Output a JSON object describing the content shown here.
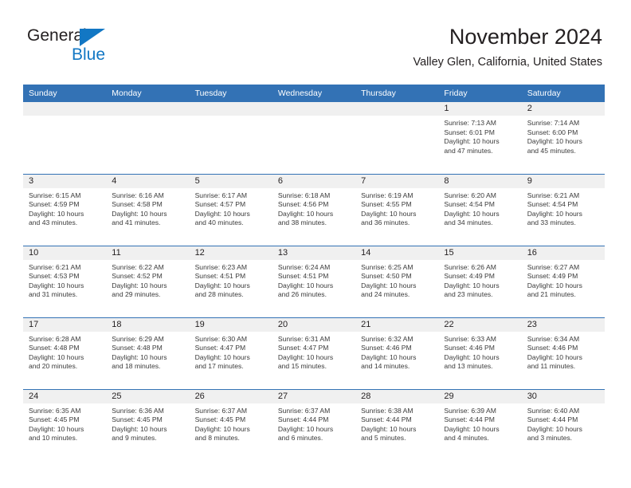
{
  "brand": {
    "name_part1": "General",
    "name_part2": "Blue",
    "accent_color": "#1277c4"
  },
  "header": {
    "title": "November 2024",
    "subtitle": "Valley Glen, California, United States"
  },
  "theme": {
    "header_blue": "#3372b5",
    "daynum_band": "#f0f0f0",
    "text": "#231f20"
  },
  "weekdays": [
    "Sunday",
    "Monday",
    "Tuesday",
    "Wednesday",
    "Thursday",
    "Friday",
    "Saturday"
  ],
  "labels": {
    "sunrise_prefix": "Sunrise:",
    "sunset_prefix": "Sunset:",
    "daylight_prefix": "Daylight:"
  },
  "weeks": [
    [
      {
        "day": "",
        "blank": true
      },
      {
        "day": "",
        "blank": true
      },
      {
        "day": "",
        "blank": true
      },
      {
        "day": "",
        "blank": true
      },
      {
        "day": "",
        "blank": true
      },
      {
        "day": "1",
        "sunrise": "Sunrise: 7:13 AM",
        "sunset": "Sunset: 6:01 PM",
        "daylight_line1": "Daylight: 10 hours",
        "daylight_line2": "and 47 minutes."
      },
      {
        "day": "2",
        "sunrise": "Sunrise: 7:14 AM",
        "sunset": "Sunset: 6:00 PM",
        "daylight_line1": "Daylight: 10 hours",
        "daylight_line2": "and 45 minutes."
      }
    ],
    [
      {
        "day": "3",
        "sunrise": "Sunrise: 6:15 AM",
        "sunset": "Sunset: 4:59 PM",
        "daylight_line1": "Daylight: 10 hours",
        "daylight_line2": "and 43 minutes."
      },
      {
        "day": "4",
        "sunrise": "Sunrise: 6:16 AM",
        "sunset": "Sunset: 4:58 PM",
        "daylight_line1": "Daylight: 10 hours",
        "daylight_line2": "and 41 minutes."
      },
      {
        "day": "5",
        "sunrise": "Sunrise: 6:17 AM",
        "sunset": "Sunset: 4:57 PM",
        "daylight_line1": "Daylight: 10 hours",
        "daylight_line2": "and 40 minutes."
      },
      {
        "day": "6",
        "sunrise": "Sunrise: 6:18 AM",
        "sunset": "Sunset: 4:56 PM",
        "daylight_line1": "Daylight: 10 hours",
        "daylight_line2": "and 38 minutes."
      },
      {
        "day": "7",
        "sunrise": "Sunrise: 6:19 AM",
        "sunset": "Sunset: 4:55 PM",
        "daylight_line1": "Daylight: 10 hours",
        "daylight_line2": "and 36 minutes."
      },
      {
        "day": "8",
        "sunrise": "Sunrise: 6:20 AM",
        "sunset": "Sunset: 4:54 PM",
        "daylight_line1": "Daylight: 10 hours",
        "daylight_line2": "and 34 minutes."
      },
      {
        "day": "9",
        "sunrise": "Sunrise: 6:21 AM",
        "sunset": "Sunset: 4:54 PM",
        "daylight_line1": "Daylight: 10 hours",
        "daylight_line2": "and 33 minutes."
      }
    ],
    [
      {
        "day": "10",
        "sunrise": "Sunrise: 6:21 AM",
        "sunset": "Sunset: 4:53 PM",
        "daylight_line1": "Daylight: 10 hours",
        "daylight_line2": "and 31 minutes."
      },
      {
        "day": "11",
        "sunrise": "Sunrise: 6:22 AM",
        "sunset": "Sunset: 4:52 PM",
        "daylight_line1": "Daylight: 10 hours",
        "daylight_line2": "and 29 minutes."
      },
      {
        "day": "12",
        "sunrise": "Sunrise: 6:23 AM",
        "sunset": "Sunset: 4:51 PM",
        "daylight_line1": "Daylight: 10 hours",
        "daylight_line2": "and 28 minutes."
      },
      {
        "day": "13",
        "sunrise": "Sunrise: 6:24 AM",
        "sunset": "Sunset: 4:51 PM",
        "daylight_line1": "Daylight: 10 hours",
        "daylight_line2": "and 26 minutes."
      },
      {
        "day": "14",
        "sunrise": "Sunrise: 6:25 AM",
        "sunset": "Sunset: 4:50 PM",
        "daylight_line1": "Daylight: 10 hours",
        "daylight_line2": "and 24 minutes."
      },
      {
        "day": "15",
        "sunrise": "Sunrise: 6:26 AM",
        "sunset": "Sunset: 4:49 PM",
        "daylight_line1": "Daylight: 10 hours",
        "daylight_line2": "and 23 minutes."
      },
      {
        "day": "16",
        "sunrise": "Sunrise: 6:27 AM",
        "sunset": "Sunset: 4:49 PM",
        "daylight_line1": "Daylight: 10 hours",
        "daylight_line2": "and 21 minutes."
      }
    ],
    [
      {
        "day": "17",
        "sunrise": "Sunrise: 6:28 AM",
        "sunset": "Sunset: 4:48 PM",
        "daylight_line1": "Daylight: 10 hours",
        "daylight_line2": "and 20 minutes."
      },
      {
        "day": "18",
        "sunrise": "Sunrise: 6:29 AM",
        "sunset": "Sunset: 4:48 PM",
        "daylight_line1": "Daylight: 10 hours",
        "daylight_line2": "and 18 minutes."
      },
      {
        "day": "19",
        "sunrise": "Sunrise: 6:30 AM",
        "sunset": "Sunset: 4:47 PM",
        "daylight_line1": "Daylight: 10 hours",
        "daylight_line2": "and 17 minutes."
      },
      {
        "day": "20",
        "sunrise": "Sunrise: 6:31 AM",
        "sunset": "Sunset: 4:47 PM",
        "daylight_line1": "Daylight: 10 hours",
        "daylight_line2": "and 15 minutes."
      },
      {
        "day": "21",
        "sunrise": "Sunrise: 6:32 AM",
        "sunset": "Sunset: 4:46 PM",
        "daylight_line1": "Daylight: 10 hours",
        "daylight_line2": "and 14 minutes."
      },
      {
        "day": "22",
        "sunrise": "Sunrise: 6:33 AM",
        "sunset": "Sunset: 4:46 PM",
        "daylight_line1": "Daylight: 10 hours",
        "daylight_line2": "and 13 minutes."
      },
      {
        "day": "23",
        "sunrise": "Sunrise: 6:34 AM",
        "sunset": "Sunset: 4:46 PM",
        "daylight_line1": "Daylight: 10 hours",
        "daylight_line2": "and 11 minutes."
      }
    ],
    [
      {
        "day": "24",
        "sunrise": "Sunrise: 6:35 AM",
        "sunset": "Sunset: 4:45 PM",
        "daylight_line1": "Daylight: 10 hours",
        "daylight_line2": "and 10 minutes."
      },
      {
        "day": "25",
        "sunrise": "Sunrise: 6:36 AM",
        "sunset": "Sunset: 4:45 PM",
        "daylight_line1": "Daylight: 10 hours",
        "daylight_line2": "and 9 minutes."
      },
      {
        "day": "26",
        "sunrise": "Sunrise: 6:37 AM",
        "sunset": "Sunset: 4:45 PM",
        "daylight_line1": "Daylight: 10 hours",
        "daylight_line2": "and 8 minutes."
      },
      {
        "day": "27",
        "sunrise": "Sunrise: 6:37 AM",
        "sunset": "Sunset: 4:44 PM",
        "daylight_line1": "Daylight: 10 hours",
        "daylight_line2": "and 6 minutes."
      },
      {
        "day": "28",
        "sunrise": "Sunrise: 6:38 AM",
        "sunset": "Sunset: 4:44 PM",
        "daylight_line1": "Daylight: 10 hours",
        "daylight_line2": "and 5 minutes."
      },
      {
        "day": "29",
        "sunrise": "Sunrise: 6:39 AM",
        "sunset": "Sunset: 4:44 PM",
        "daylight_line1": "Daylight: 10 hours",
        "daylight_line2": "and 4 minutes."
      },
      {
        "day": "30",
        "sunrise": "Sunrise: 6:40 AM",
        "sunset": "Sunset: 4:44 PM",
        "daylight_line1": "Daylight: 10 hours",
        "daylight_line2": "and 3 minutes."
      }
    ]
  ]
}
